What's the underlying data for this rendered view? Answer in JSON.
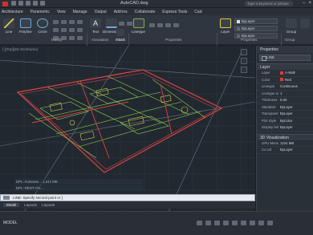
{
  "window": {
    "title": "AutoCAD.dwg",
    "search_placeholder": "Type a keyword or phrase"
  },
  "menu": {
    "items": [
      "Architecture",
      "Parametric",
      "View",
      "Manage",
      "Output",
      "Add-ins",
      "Collaborate",
      "Express Tools",
      "Cad"
    ]
  },
  "ribbon": {
    "tools": {
      "line": "Line",
      "polyline": "Polyline",
      "circle": "Circle",
      "arc": "Arc",
      "text": "Text",
      "dimension": "Dimension",
      "leader": "Leader",
      "table": "Table",
      "linetype": "Linetype",
      "layer": "Layer",
      "group": "Group",
      "insert": "Insert",
      "block": "Block"
    },
    "panels": {
      "modify": "Modify",
      "annotation": "Annotation",
      "block": "Block",
      "properties": "Properties",
      "group": "Group"
    },
    "dropdowns": {
      "layer": "ByLayer",
      "color": "ByLayer",
      "linetype": "ByLayer"
    }
  },
  "viewport": {
    "label": "[-][Top][2D Wireframe]"
  },
  "command": {
    "history": [
      "DPL: Autosave... 1,241 MB",
      "DPL: RENT: 0% ..."
    ],
    "prompt": "LINE: Specify second point or ]"
  },
  "layout_tabs": [
    "Model",
    "Layout1",
    "Layout2"
  ],
  "status": {
    "model": "MODEL"
  },
  "properties_panel": {
    "title": "Properties",
    "selection": "LINE",
    "section_general": "Layer",
    "rows": [
      {
        "k": "Layer",
        "v": "A-Wall",
        "sw": "#e03a3a"
      },
      {
        "k": "Color",
        "v": "Red",
        "sw": "#e03a3a"
      },
      {
        "k": "Linetype",
        "v": "Continuous",
        "sw": ""
      },
      {
        "k": "Linetype scale",
        "v": "1",
        "sw": ""
      },
      {
        "k": "Thickness",
        "v": "0.00",
        "sw": ""
      },
      {
        "k": "Standard",
        "v": "ByLayer",
        "sw": ""
      },
      {
        "k": "Transparency",
        "v": "ByLayer",
        "sw": ""
      },
      {
        "k": "Plot Style",
        "v": "ByColor",
        "sw": ""
      },
      {
        "k": "Display behavior",
        "v": "ByLayer",
        "sw": ""
      }
    ],
    "section_3d": "3D Visualization",
    "rows3d": [
      {
        "k": "GPU Memory",
        "v": "1241 MB"
      },
      {
        "k": "Co col",
        "v": "ByLayer"
      }
    ]
  },
  "colors": {
    "accent": "#d0312d",
    "wall_red": "#d94545",
    "wire_green": "#8fd14f",
    "wire_yellow": "#d8cf4a"
  }
}
